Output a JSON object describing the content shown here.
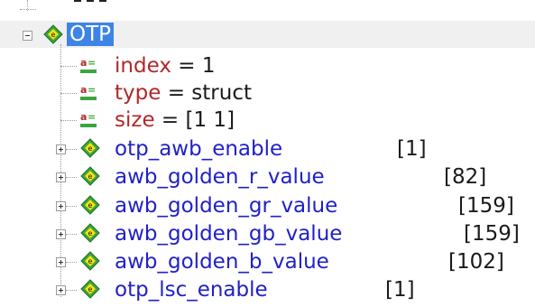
{
  "colors": {
    "selection": "#3d84e6",
    "struct_label": "#2020c8",
    "field_label": "#b02828",
    "icon_green": "#3aa640",
    "icon_yellow": "#f2e20c"
  },
  "root": {
    "label": "OTP",
    "icon": "struct-icon",
    "expanded": true
  },
  "fields": [
    {
      "name": "index",
      "op": "=",
      "value": "1",
      "icon": "field-icon"
    },
    {
      "name": "type",
      "op": "=",
      "value": "struct",
      "icon": "field-icon"
    },
    {
      "name": "size",
      "op": "=",
      "value": "[1 1]",
      "icon": "field-icon"
    }
  ],
  "children": [
    {
      "name": "otp_awb_enable",
      "value": "[1]",
      "icon": "struct-icon"
    },
    {
      "name": "awb_golden_r_value",
      "value": "[82]",
      "icon": "struct-icon"
    },
    {
      "name": "awb_golden_gr_value",
      "value": "[159]",
      "icon": "struct-icon"
    },
    {
      "name": "awb_golden_gb_value",
      "value": "[159]",
      "icon": "struct-icon"
    },
    {
      "name": "awb_golden_b_value",
      "value": "[102]",
      "icon": "struct-icon"
    },
    {
      "name": "otp_lsc_enable",
      "value": "[1]",
      "icon": "struct-icon"
    }
  ]
}
